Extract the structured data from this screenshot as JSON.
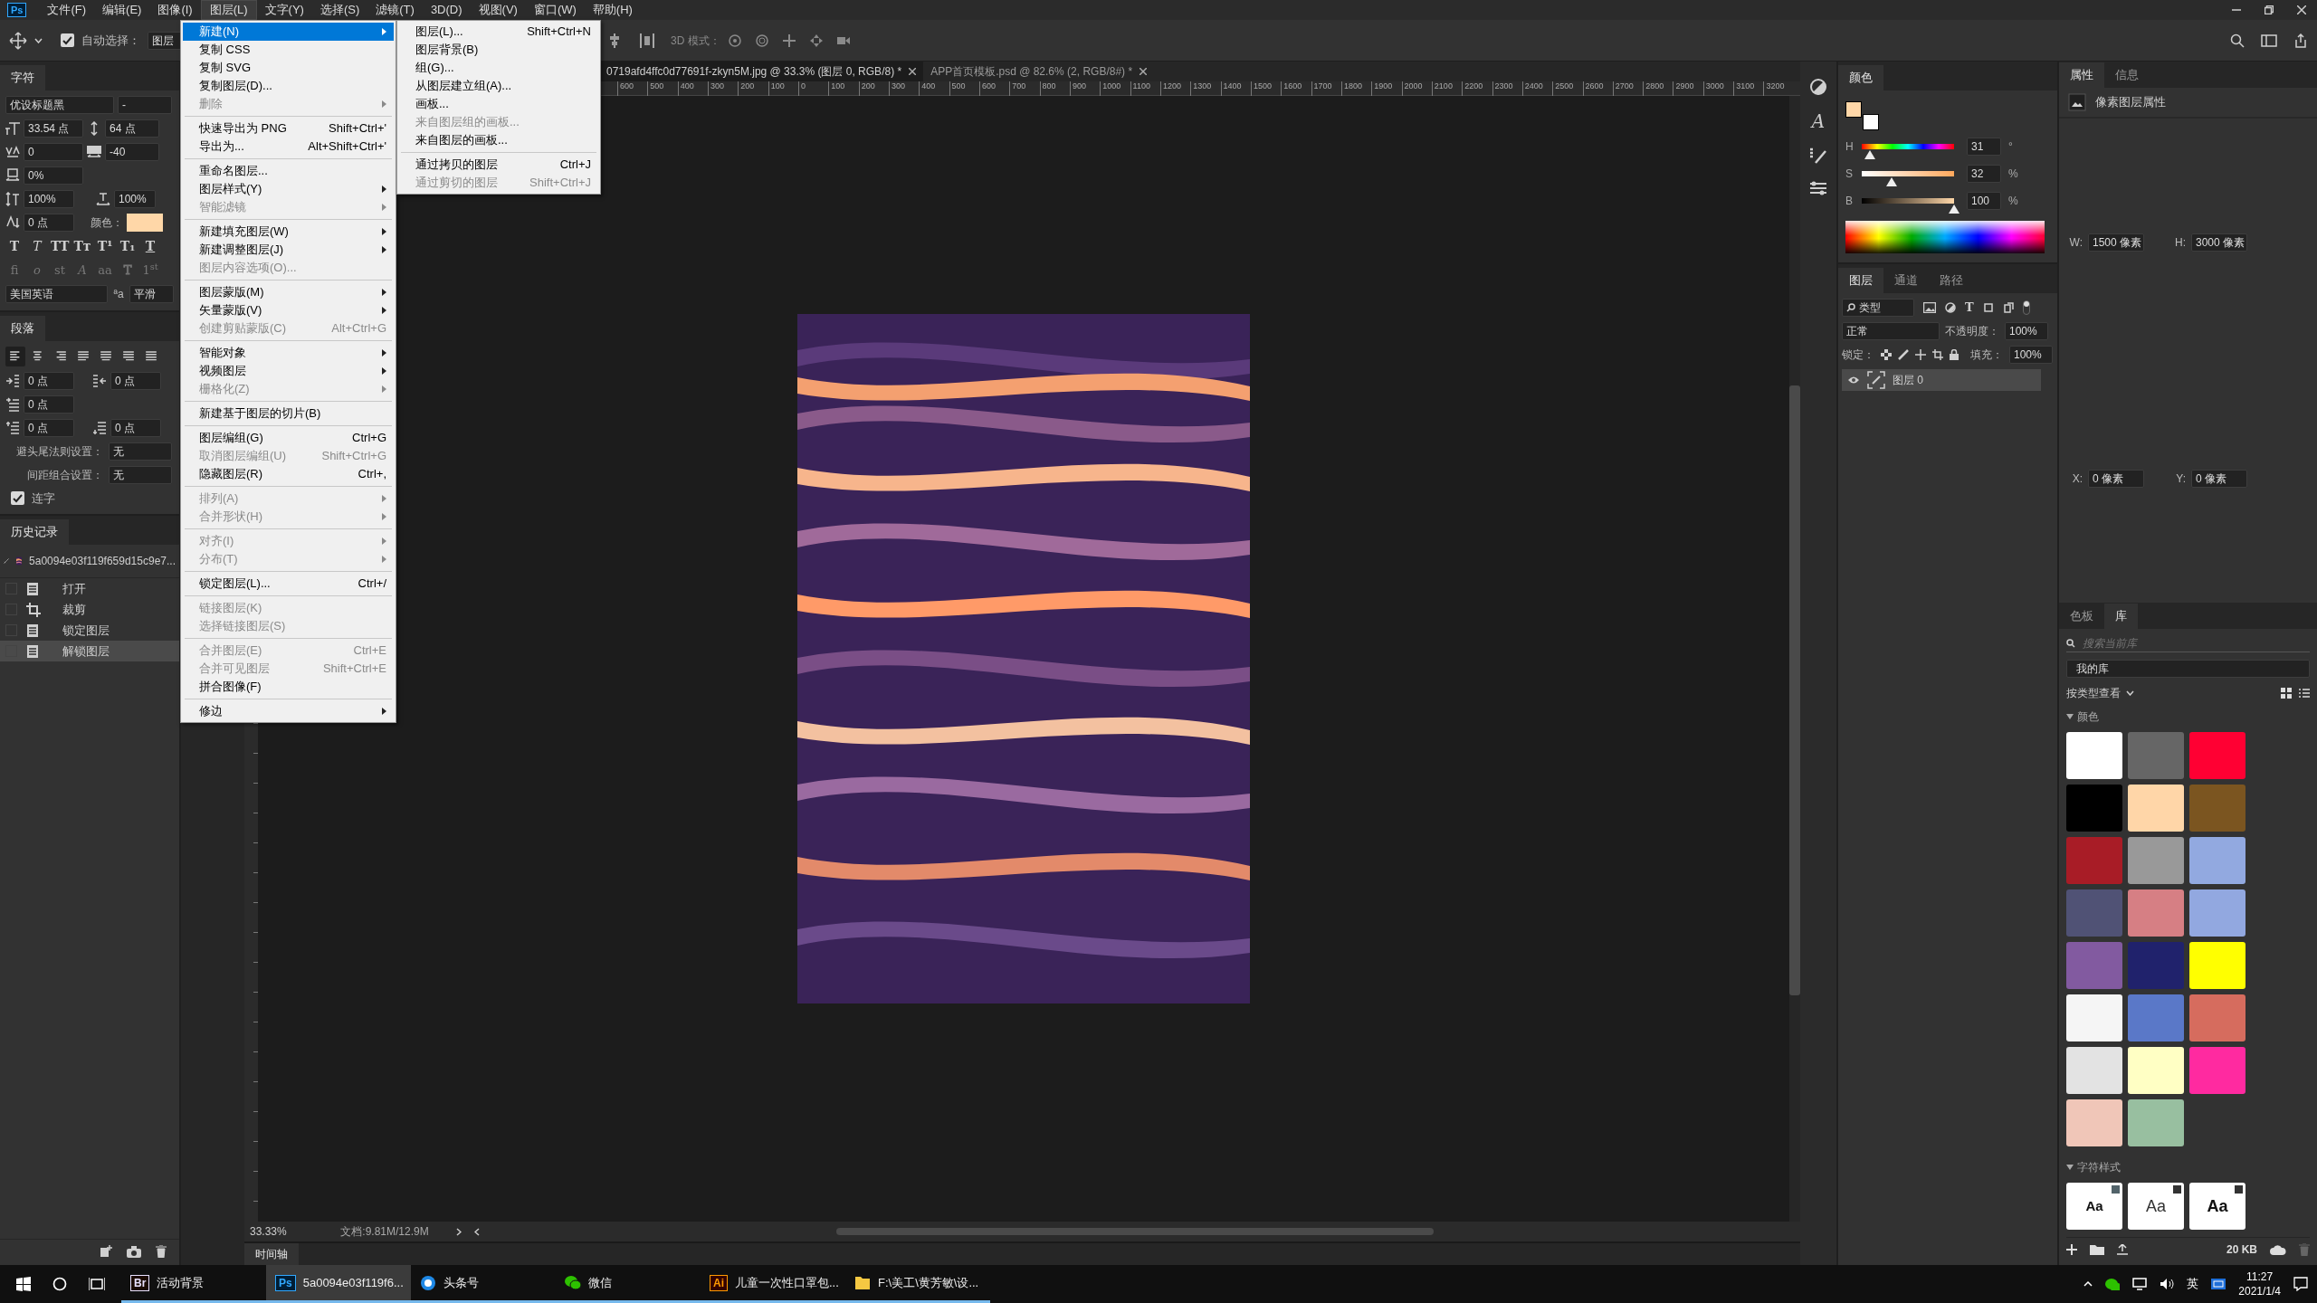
{
  "menubar": {
    "logo": "Ps",
    "items": [
      {
        "label": "文件(F)",
        "selected": false
      },
      {
        "label": "编辑(E)",
        "selected": false
      },
      {
        "label": "图像(I)",
        "selected": false
      },
      {
        "label": "图层(L)",
        "selected": true
      },
      {
        "label": "文字(Y)",
        "selected": false
      },
      {
        "label": "选择(S)",
        "selected": false
      },
      {
        "label": "滤镜(T)",
        "selected": false
      },
      {
        "label": "3D(D)",
        "selected": false
      },
      {
        "label": "视图(V)",
        "selected": false
      },
      {
        "label": "窗口(W)",
        "selected": false
      },
      {
        "label": "帮助(H)",
        "selected": false
      }
    ]
  },
  "options_bar": {
    "auto_select_label": "自动选择：",
    "auto_select_checked": true,
    "target": "图层",
    "mode_label": "3D 模式："
  },
  "layer_menu": {
    "groups": [
      [
        {
          "label": "新建(N)",
          "kind": "submenu",
          "selected": true,
          "disabled": false
        },
        {
          "label": "复制 CSS",
          "kind": "command",
          "selected": false,
          "disabled": false
        },
        {
          "label": "复制 SVG",
          "kind": "command",
          "selected": false,
          "disabled": false
        },
        {
          "label": "复制图层(D)...",
          "kind": "command",
          "selected": false,
          "disabled": false
        },
        {
          "label": "删除",
          "kind": "submenu",
          "selected": false,
          "disabled": true
        }
      ],
      [
        {
          "label": "快速导出为 PNG",
          "shortcut": "Shift+Ctrl+'",
          "kind": "command",
          "selected": false,
          "disabled": false
        },
        {
          "label": "导出为...",
          "shortcut": "Alt+Shift+Ctrl+'",
          "kind": "command",
          "selected": false,
          "disabled": false
        }
      ],
      [
        {
          "label": "重命名图层...",
          "kind": "command",
          "selected": false,
          "disabled": false
        },
        {
          "label": "图层样式(Y)",
          "kind": "submenu",
          "selected": false,
          "disabled": false
        },
        {
          "label": "智能滤镜",
          "kind": "submenu",
          "selected": false,
          "disabled": true
        }
      ],
      [
        {
          "label": "新建填充图层(W)",
          "kind": "submenu",
          "selected": false,
          "disabled": false
        },
        {
          "label": "新建调整图层(J)",
          "kind": "submenu",
          "selected": false,
          "disabled": false
        },
        {
          "label": "图层内容选项(O)...",
          "kind": "command",
          "selected": false,
          "disabled": true
        }
      ],
      [
        {
          "label": "图层蒙版(M)",
          "kind": "submenu",
          "selected": false,
          "disabled": false
        },
        {
          "label": "矢量蒙版(V)",
          "kind": "submenu",
          "selected": false,
          "disabled": false
        },
        {
          "label": "创建剪贴蒙版(C)",
          "shortcut": "Alt+Ctrl+G",
          "kind": "command",
          "selected": false,
          "disabled": true
        }
      ],
      [
        {
          "label": "智能对象",
          "kind": "submenu",
          "selected": false,
          "disabled": false
        },
        {
          "label": "视频图层",
          "kind": "submenu",
          "selected": false,
          "disabled": false
        },
        {
          "label": "栅格化(Z)",
          "kind": "submenu",
          "selected": false,
          "disabled": true
        }
      ],
      [
        {
          "label": "新建基于图层的切片(B)",
          "kind": "command",
          "selected": false,
          "disabled": false
        }
      ],
      [
        {
          "label": "图层编组(G)",
          "shortcut": "Ctrl+G",
          "kind": "command",
          "selected": false,
          "disabled": false
        },
        {
          "label": "取消图层编组(U)",
          "shortcut": "Shift+Ctrl+G",
          "kind": "command",
          "selected": false,
          "disabled": true
        },
        {
          "label": "隐藏图层(R)",
          "shortcut": "Ctrl+,",
          "kind": "command",
          "selected": false,
          "disabled": false
        }
      ],
      [
        {
          "label": "排列(A)",
          "kind": "submenu",
          "selected": false,
          "disabled": true
        },
        {
          "label": "合并形状(H)",
          "kind": "submenu",
          "selected": false,
          "disabled": true
        }
      ],
      [
        {
          "label": "对齐(I)",
          "kind": "submenu",
          "selected": false,
          "disabled": true
        },
        {
          "label": "分布(T)",
          "kind": "submenu",
          "selected": false,
          "disabled": true
        }
      ],
      [
        {
          "label": "锁定图层(L)...",
          "shortcut": "Ctrl+/",
          "kind": "command",
          "selected": false,
          "disabled": false
        }
      ],
      [
        {
          "label": "链接图层(K)",
          "kind": "command",
          "selected": false,
          "disabled": true
        },
        {
          "label": "选择链接图层(S)",
          "kind": "command",
          "selected": false,
          "disabled": true
        }
      ],
      [
        {
          "label": "合并图层(E)",
          "shortcut": "Ctrl+E",
          "kind": "command",
          "selected": false,
          "disabled": true
        },
        {
          "label": "合并可见图层",
          "shortcut": "Shift+Ctrl+E",
          "kind": "command",
          "selected": false,
          "disabled": true
        },
        {
          "label": "拼合图像(F)",
          "kind": "command",
          "selected": false,
          "disabled": false
        }
      ],
      [
        {
          "label": "修边",
          "kind": "submenu",
          "selected": false,
          "disabled": false
        }
      ]
    ]
  },
  "new_submenu": {
    "groups": [
      [
        {
          "label": "图层(L)...",
          "shortcut": "Shift+Ctrl+N",
          "selected": false,
          "disabled": false
        },
        {
          "label": "图层背景(B)",
          "selected": false,
          "disabled": false
        },
        {
          "label": "组(G)...",
          "selected": false,
          "disabled": false
        },
        {
          "label": "从图层建立组(A)...",
          "selected": false,
          "disabled": false
        },
        {
          "label": "画板...",
          "selected": false,
          "disabled": false
        },
        {
          "label": "来自图层组的画板...",
          "selected": false,
          "disabled": true
        },
        {
          "label": "来自图层的画板...",
          "selected": false,
          "disabled": false
        }
      ],
      [
        {
          "label": "通过拷贝的图层",
          "shortcut": "Ctrl+J",
          "selected": false,
          "disabled": false
        },
        {
          "label": "通过剪切的图层",
          "shortcut": "Shift+Ctrl+J",
          "selected": false,
          "disabled": true
        }
      ]
    ]
  },
  "character_panel": {
    "tab": "字符",
    "font_family": "优设标题黑",
    "font_style": "-",
    "size": "33.54 点",
    "leading": "64 点",
    "kerning": "0",
    "tracking": "-40",
    "tsume": "0%",
    "vertical_scale": "100%",
    "horizontal_scale": "100%",
    "baseline_shift": "0 点",
    "color_label": "颜色：",
    "color": "#ffd7a8",
    "type_styles": [
      {
        "label": "T",
        "kind": "bold"
      },
      {
        "label": "T",
        "kind": "italic"
      },
      {
        "label": "TT",
        "kind": "caps"
      },
      {
        "label": "Tт",
        "kind": "smallcaps"
      },
      {
        "label": "T¹",
        "kind": "super"
      },
      {
        "label": "T₁",
        "kind": "sub"
      },
      {
        "label": "T",
        "kind": "underline"
      }
    ],
    "opentype_styles": [
      {
        "label": "fi",
        "kind": "plain"
      },
      {
        "label": "o",
        "kind": "italic"
      },
      {
        "label": "st",
        "kind": "plain"
      },
      {
        "label": "A",
        "kind": "italic"
      },
      {
        "label": "aa",
        "kind": "plain"
      },
      {
        "label": "T",
        "kind": "outline"
      },
      {
        "label": "1$^{st}$",
        "kind": "plain"
      }
    ],
    "language": "美国英语",
    "antialias_glyph": "ªa",
    "antialias": "平滑"
  },
  "paragraph_panel": {
    "tab": "段落",
    "alignments": [
      {
        "selected": true
      },
      {
        "selected": false
      },
      {
        "selected": false
      },
      {
        "selected": false
      },
      {
        "selected": false
      },
      {
        "selected": false
      },
      {
        "selected": false
      }
    ],
    "indent_left": "0 点",
    "indent_right": "0 点",
    "indent_first": "0 点",
    "space_before": "0 点",
    "space_after": "0 点",
    "kinsoku_label": "避头尾法则设置：",
    "kinsoku": "无",
    "mojikumi_label": "间距组合设置：",
    "mojikumi": "无",
    "hyphenate_label": "连字",
    "hyphenate": true
  },
  "history_panel": {
    "tab": "历史记录",
    "snapshot": "5a0094e03f119f659d15c9e7...",
    "items": [
      {
        "label": "打开",
        "kind": "document",
        "selected": false
      },
      {
        "label": "裁剪",
        "kind": "crop",
        "selected": false
      },
      {
        "label": "锁定图层",
        "kind": "document",
        "selected": false
      },
      {
        "label": "解锁图层",
        "kind": "document",
        "selected": true
      }
    ]
  },
  "document": {
    "tabs": [
      {
        "label": "0719afd4ffc0d77691f-zkyn5M.jpg @ 33.3% (图层 0, RGB/8) *",
        "selected": true
      },
      {
        "label": "APP首页模板.psd @ 82.6% (2, RGB/8#) *",
        "selected": false
      }
    ],
    "ruler": [
      "600",
      "500",
      "400",
      "300",
      "200",
      "100",
      "0",
      "100",
      "200",
      "300",
      "400",
      "500",
      "600",
      "700",
      "800",
      "900",
      "1000",
      "1100",
      "1200",
      "1300",
      "1400",
      "1500",
      "1600",
      "1700",
      "1800",
      "1900",
      "2000",
      "2100",
      "2200",
      "2300",
      "2400",
      "2500",
      "2600",
      "2700",
      "2800",
      "2900",
      "3000",
      "3100",
      "3200"
    ],
    "zoom": "33.33%",
    "doc_info": "文档:9.81M/12.9M",
    "timeline_tab": "时间轴"
  },
  "icon_strip": {
    "character_glyph": "A"
  },
  "color_panel": {
    "tab": "颜色",
    "swatches": [
      {
        "kind": "foreground",
        "color": "#ffd7a8"
      },
      {
        "kind": "background",
        "color": "#ffffff"
      }
    ],
    "channels": [
      {
        "name": "H",
        "value": "31",
        "unit": "°",
        "level": 0.086
      },
      {
        "name": "S",
        "value": "32",
        "unit": "%",
        "level": 0.32
      },
      {
        "name": "B",
        "value": "100",
        "unit": "%",
        "level": 1
      }
    ]
  },
  "layers_panel": {
    "tabs": [
      {
        "label": "图层",
        "selected": true
      },
      {
        "label": "通道",
        "selected": false
      },
      {
        "label": "路径",
        "selected": false
      }
    ],
    "filter": "类型",
    "type_filter_glyph": "T",
    "blend_mode": "正常",
    "opacity_label": "不透明度：",
    "opacity": "100%",
    "lock_label": "锁定：",
    "fill_label": "填充：",
    "fill": "100%",
    "layers": [
      {
        "name": "图层 0",
        "visible": true,
        "selected": true
      }
    ]
  },
  "properties_panel": {
    "tabs": [
      {
        "label": "属性",
        "selected": true
      },
      {
        "label": "信息",
        "selected": false
      }
    ],
    "title": "像素图层属性",
    "fields": [
      {
        "label": "W:",
        "value": "1500 像素"
      },
      {
        "label": "H:",
        "value": "3000 像素"
      },
      {
        "label": "X:",
        "value": "0 像素"
      },
      {
        "label": "Y:",
        "value": "0 像素"
      }
    ]
  },
  "library_panel": {
    "tabs": [
      {
        "label": "色板",
        "selected": false
      },
      {
        "label": "库",
        "selected": true
      }
    ],
    "search_placeholder": "搜索当前库",
    "library": "我的库",
    "view_by": "按类型查看",
    "colors_heading": "颜色",
    "swatches": [
      {
        "color": "#ffffff"
      },
      {
        "color": "#666666"
      },
      {
        "color": "#ff0033"
      },
      {
        "color": "#000000"
      },
      {
        "color": "#ffd6a8"
      },
      {
        "color": "#7b5520"
      },
      {
        "color": "#a81c26"
      },
      {
        "color": "#999999"
      },
      {
        "color": "#92a9e0"
      },
      {
        "color": "#505275"
      },
      {
        "color": "#d67f84"
      },
      {
        "color": "#92a8e0"
      },
      {
        "color": "#825aa0"
      },
      {
        "color": "#20226c"
      },
      {
        "color": "#ffff00"
      },
      {
        "color": "#f5f5f5"
      },
      {
        "color": "#5a78c8"
      },
      {
        "color": "#d66c5e"
      },
      {
        "color": "#e3e3e3"
      },
      {
        "color": "#ffffc4"
      },
      {
        "color": "#ff2aa0"
      },
      {
        "color": "#f0c6b8"
      },
      {
        "color": "#98bfa0"
      }
    ],
    "styles_heading": "字符样式",
    "char_styles": [
      {
        "label": "Aa",
        "kind": "heavy"
      },
      {
        "label": "Aa",
        "kind": "light"
      },
      {
        "label": "Aa",
        "kind": "bold"
      }
    ],
    "size": "20 KB"
  },
  "taskbar": {
    "items": [
      {
        "badge": "Br",
        "label": "活动背景",
        "kind": "bridge",
        "selected": false
      },
      {
        "badge": "Ps",
        "label": "5a0094e03f119f6...",
        "kind": "photoshop",
        "selected": true
      },
      {
        "label": "头条号",
        "kind": "toutiao",
        "selected": false
      },
      {
        "label": "微信",
        "kind": "wechat",
        "selected": false
      },
      {
        "badge": "Ai",
        "label": "儿童一次性口罩包...",
        "kind": "illustrator",
        "selected": false
      },
      {
        "label": "F:\\美工\\黄芳敏\\设...",
        "kind": "folder",
        "selected": false
      }
    ],
    "ime": "英",
    "time": "11:27",
    "date": "2021/1/4"
  }
}
